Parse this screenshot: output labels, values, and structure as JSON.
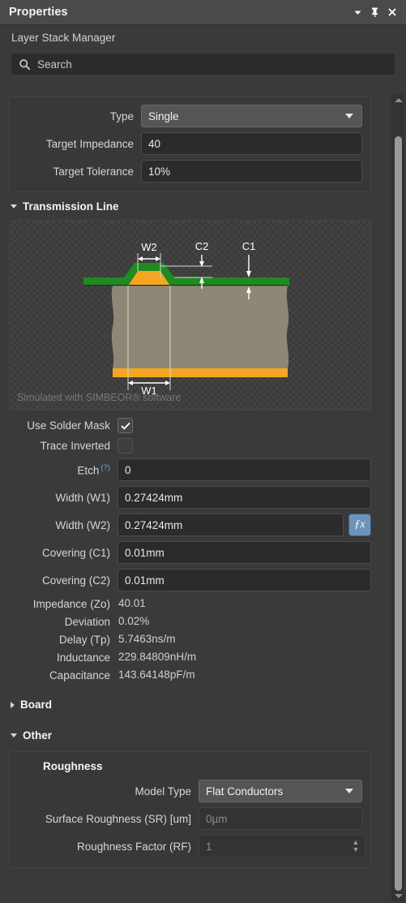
{
  "window": {
    "title": "Properties",
    "controls": [
      {
        "name": "chevron-down-icon",
        "label": "▼"
      },
      {
        "name": "pin-icon",
        "label": "pin"
      },
      {
        "name": "close-icon",
        "label": "✕"
      }
    ]
  },
  "subheader": {
    "text": "Layer Stack Manager"
  },
  "search": {
    "placeholder": "Search",
    "icon": "search-icon"
  },
  "top_group": {
    "rows": [
      {
        "label": "Type",
        "value": "Single",
        "kind": "combo"
      },
      {
        "label": "Target Impedance",
        "value": "40",
        "kind": "text"
      },
      {
        "label": "Target Tolerance",
        "value": "10%",
        "kind": "text"
      }
    ]
  },
  "sections": {
    "transmission_line": {
      "title": "Transmission Line",
      "expanded": true
    },
    "board": {
      "title": "Board",
      "expanded": false
    },
    "other": {
      "title": "Other",
      "expanded": true
    }
  },
  "diagram": {
    "caption": "Simulated with SIMBEOR® software",
    "annotations": [
      "W2",
      "C2",
      "C1",
      "W1"
    ],
    "colors": {
      "solder_mask": "#1f8a1f",
      "copper": "#f5a623",
      "dielectric": "#8d8777",
      "dimension_line": "#ffffff"
    }
  },
  "transmission_line_fields": {
    "use_solder_mask": {
      "label": "Use Solder Mask",
      "checked": true
    },
    "trace_inverted": {
      "label": "Trace Inverted",
      "checked": false
    },
    "etch": {
      "label": "Etch",
      "sup": "(?)",
      "value": "0"
    },
    "width_w1": {
      "label": "Width (W1)",
      "value": "0.27424mm"
    },
    "width_w2": {
      "label": "Width (W2)",
      "value": "0.27424mm",
      "fx": "ƒx"
    },
    "covering_c1": {
      "label": "Covering (C1)",
      "value": "0.01mm"
    },
    "covering_c2": {
      "label": "Covering (C2)",
      "value": "0.01mm"
    },
    "impedance_zo": {
      "label": "Impedance (Zo)",
      "value": "40.01"
    },
    "deviation": {
      "label": "Deviation",
      "value": "0.02%"
    },
    "delay_tp": {
      "label": "Delay (Tp)",
      "value": "5.7463ns/m"
    },
    "inductance": {
      "label": "Inductance",
      "value": "229.84809nH/m"
    },
    "capacitance": {
      "label": "Capacitance",
      "value": "143.64148pF/m"
    }
  },
  "other_section": {
    "roughness_title": "Roughness",
    "model_type": {
      "label": "Model Type",
      "value": "Flat Conductors"
    },
    "surface_roughness": {
      "label": "Surface Roughness (SR) [um]",
      "placeholder": "0µm"
    },
    "roughness_factor": {
      "label": "Roughness Factor (RF)",
      "placeholder": "1"
    }
  }
}
